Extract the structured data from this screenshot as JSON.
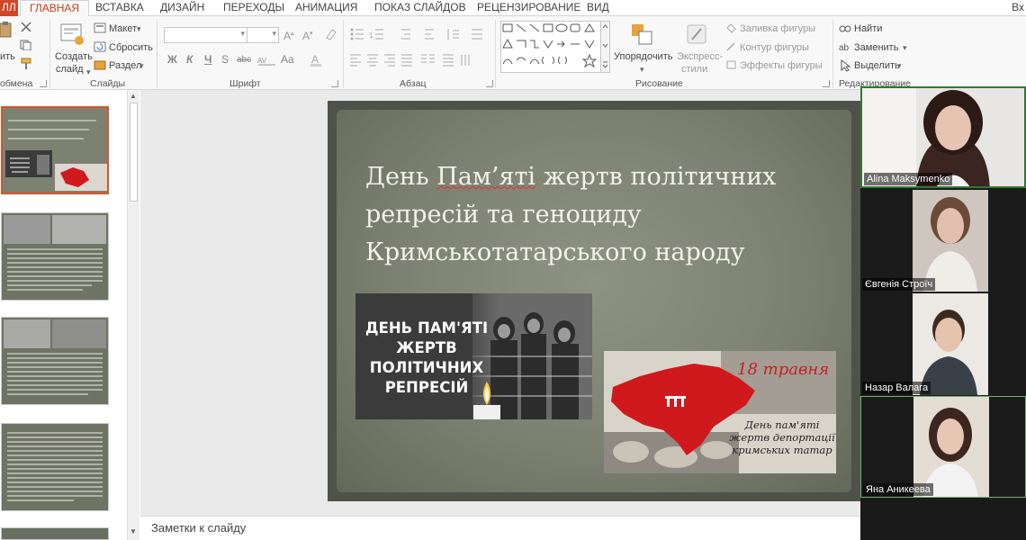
{
  "tabs": {
    "file": "ЛЛ",
    "items": [
      "ГЛАВНАЯ",
      "ВСТАВКА",
      "ДИЗАЙН",
      "ПЕРЕХОДЫ",
      "АНИМАЦИЯ",
      "ПОКАЗ СЛАЙДОВ",
      "РЕЦЕНЗИРОВАНИЕ",
      "ВИД"
    ],
    "active": "ГЛАВНАЯ",
    "right_text": "Вх"
  },
  "ribbon": {
    "clipboard": {
      "paste": "ить",
      "label": "обмена"
    },
    "slides": {
      "create": "Создать",
      "create2": "слайд",
      "layout": "Макет",
      "reset": "Сбросить",
      "section": "Раздел",
      "label": "Слайды"
    },
    "font": {
      "label": "Шрифт",
      "bold": "Ж",
      "italic": "К",
      "underline": "Ч",
      "strike": "S",
      "spacing": "abc",
      "case": "Aa"
    },
    "paragraph": {
      "label": "Абзац"
    },
    "drawing": {
      "arrange": "Упорядочить",
      "styles": "Экспресс-",
      "styles2": "стили",
      "fill": "Заливка фигуры",
      "outline": "Контур фигуры",
      "effects": "Эффекты фигуры",
      "label": "Рисование"
    },
    "editing": {
      "find": "Найти",
      "replace": "Заменить",
      "select": "Выделить",
      "label": "Редактирование"
    }
  },
  "slide": {
    "title_before": "День ",
    "title_underlined": "Пам’яті",
    "title_after": " жертв політичних репресій та геноциду Кримськотатарського народу",
    "image1_text": "ДЕНЬ ПАМ'ЯТІ ЖЕРТВ ПОЛІТИЧНИХ РЕПРЕСІЙ",
    "image2_date": "18 травня",
    "image2_text": "День пам'яті жертв депортації кримських татар"
  },
  "notes": {
    "placeholder": "Заметки к слайду"
  },
  "participants": [
    "Alina Maksymenko",
    "Євгенія Строїч",
    "Назар Валага",
    "Яна Аникеева"
  ],
  "colors": {
    "accent": "#d24726",
    "slide_bg": "#7d8172",
    "speaker_border": "#2f7a2f",
    "crimea_red": "#d0191d"
  }
}
